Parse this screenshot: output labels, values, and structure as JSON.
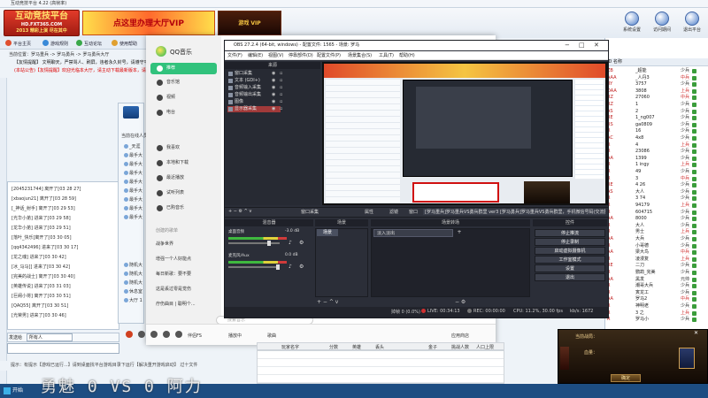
{
  "platform": {
    "title": "互动竞技平台 4.22 (高帧率)",
    "logo": {
      "line1": "互动竞技平台",
      "line2": "HD.FXT365.COM",
      "line3": "2013 精彩上演 尽在其中"
    },
    "ad_text": "点这里办理大厅VIP",
    "ad2_text": "游戏 VIP",
    "top_icons": [
      "系统设置",
      "访问期间",
      "退出平台"
    ],
    "nav": [
      "平台主页",
      "游戏规则",
      "互动论坛",
      "使用帮助"
    ],
    "breadcrumb": "当前位置：罗马重兵 -> 罗马勇兵 -> 罗马勇兵大厅",
    "notice1": "【友情提醒】 文明聊天，严禁骂人、刷屏，违者永久封号，请遵守平台规定。",
    "notice2": "(本站公告)【友情提醒】欢迎光临本大厅，请主动下载最新版本，请遵守平台规定。",
    "status": "提示：有提示【游戏已运行...】请到桌面找平台游戏目录下运行【解决重开游戏启动】 过十文件",
    "score": "勇魅 0 VS 0 阿力",
    "start": "开始"
  },
  "chat": {
    "lines": [
      "[2045231744] 离开了[03 28 27]",
      "[xbaojun21] 离开了[03 28 59]",
      "[_神话_射手] 离开了[03 29 53]",
      "[光华小弟] 进来了[03 29 58]",
      "[龙华小弟] 进来了[03 29 51]",
      "[落叶_快乐]离开了[03 30 05]",
      "[qq4342496] 进来了[03 30 17]",
      "[龙之魂] 进来了[03 30 42]",
      "[冰_马马]] 进来了[03 30 42]",
      "[完美的战士] 离开了[03 30 40]",
      "[英雄传说] 进来了[03 31 03]",
      "[巨阙小将] 离开了[03 30 51]",
      "[QAQ55] 离开了[03 30 51]",
      "[光荣男] 进来了[03 30 46]"
    ],
    "to_label": "发送给",
    "to_value": "所有人"
  },
  "members": {
    "title": "当前在线人员",
    "rows": [
      "_天涯",
      "最手大",
      "最手大",
      "最手大",
      "最手大",
      "最手大",
      "最手大",
      "最手大",
      "最手大",
      "随机大",
      "随机大",
      "随机大",
      "休息室",
      "大厅 1"
    ]
  },
  "user_list": {
    "header": "ID    名称",
    "rows": [
      {
        "id": "ZB",
        "name": "_超能",
        "status": "少兵"
      },
      {
        "id": "AAA",
        "name": "_人丹3",
        "status": "中兵"
      },
      {
        "id": "RY",
        "name": "3757",
        "status": "少兵"
      },
      {
        "id": "DAA",
        "name": "3808",
        "status": "上兵"
      },
      {
        "id": "RZ",
        "name": "27060",
        "status": "中兵"
      },
      {
        "id": "RZ",
        "name": "1",
        "status": "少兵"
      },
      {
        "id": "AS",
        "name": "2",
        "status": "少兵"
      },
      {
        "id": "RE",
        "name": "1_ng007",
        "status": "少兵"
      },
      {
        "id": "RS",
        "name": "ga0809",
        "status": "少兵"
      },
      {
        "id": "R",
        "name": "16",
        "status": "少兵"
      },
      {
        "id": "AC",
        "name": "4x8",
        "status": "少兵"
      },
      {
        "id": "R",
        "name": "4",
        "status": "上兵"
      },
      {
        "id": "R",
        "name": "23086",
        "status": "少兵"
      },
      {
        "id": "AA",
        "name": "1399",
        "status": "少兵"
      },
      {
        "id": "R",
        "name": "1 ingy",
        "status": "上兵"
      },
      {
        "id": "R",
        "name": "49",
        "status": "少兵"
      },
      {
        "id": "R",
        "name": "3",
        "status": "中兵"
      },
      {
        "id": "RE",
        "name": "4 26",
        "status": "少兵"
      },
      {
        "id": "AS",
        "name": "大人",
        "status": "少兵"
      },
      {
        "id": "R",
        "name": "3 74",
        "status": "少兵"
      },
      {
        "id": "R",
        "name": "94179",
        "status": "上兵"
      },
      {
        "id": "R",
        "name": "604715",
        "status": "少兵"
      },
      {
        "id": "AA",
        "name": "8000",
        "status": "少兵"
      },
      {
        "id": "R",
        "name": "大人",
        "status": "少兵"
      },
      {
        "id": "R",
        "name": "男士",
        "status": "上兵"
      },
      {
        "id": "AA",
        "name": "大兵",
        "status": "少兵"
      },
      {
        "id": "R",
        "name": "小哥德",
        "status": "少兵"
      },
      {
        "id": "AA",
        "name": "梁大鸟",
        "status": "中兵"
      },
      {
        "id": "R",
        "name": "凌漫复",
        "status": "上兵"
      },
      {
        "id": "RE",
        "name": "二刀",
        "status": "少兵"
      },
      {
        "id": "R",
        "name": "鹦鹉_完美",
        "status": "少兵"
      },
      {
        "id": "AA",
        "name": "黑发",
        "status": "元帅"
      },
      {
        "id": "R",
        "name": "潮哥大兵",
        "status": "少兵"
      },
      {
        "id": "R",
        "name": "寅龙工",
        "status": "少兵"
      },
      {
        "id": "AA",
        "name": "罗马2",
        "status": "中兵"
      },
      {
        "id": "R",
        "name": "神明老",
        "status": "少兵"
      },
      {
        "id": "R",
        "name": "3 之",
        "status": "上兵"
      },
      {
        "id": "R",
        "name": "罗马小",
        "status": "少兵"
      }
    ]
  },
  "qqmusic": {
    "brand": "QQ音乐",
    "nav": [
      "推荐",
      "音乐馆",
      "视频",
      "电台"
    ],
    "my_music": [
      "我喜欢",
      "本地和下载",
      "最近播放",
      "试听列表",
      "已购音乐"
    ],
    "create_title": "创建的歌单",
    "playlists": [
      "战争世界",
      "增强一个人好能点",
      "每日新歌：要不要",
      "这是丢过零是觉伤",
      "疗伤曲目 | 聪明个..."
    ],
    "search_placeholder": "搜索音乐",
    "song": "伴侣FS",
    "lyric": "播放中",
    "settings": "歌曲",
    "right_actions": "应用商店",
    "table_heads": [
      "玩家名字",
      "分数",
      "英雄",
      "丢头",
      "金子",
      "挑战人数",
      "人口上限"
    ]
  },
  "obs": {
    "title": "OBS 27.2.4 (64-bit, windows) - 配置文件: 1565 - 场景: 罗马",
    "menu": [
      "文件(F)",
      "编辑(E)",
      "视图(V)",
      "停靠部件(D)",
      "配置文件(P)",
      "场景集合(S)",
      "工具(T)",
      "帮助(H)"
    ],
    "scenes_header": "来源",
    "scenes": [
      "窗口采集",
      "文本 (GDI+)",
      "音频输入采集",
      "音频输出采集",
      "图像",
      "显示器采集"
    ],
    "toolbar": [
      "窗口采集",
      "属性",
      "滤镜",
      "窗口",
      "[罗马重兵]罗马重兵VS勇兵群里 ver3 [罗马勇兵]罗马重兵VS勇兵群里，手机微信号码(交流群) 1"
    ],
    "sources_header": "混音器",
    "mixer": [
      {
        "label": "桌面音频",
        "db": "-3.0 dB"
      },
      {
        "label": "麦克风/Aux",
        "db": "0.0 dB"
      }
    ],
    "transition_header": "场景",
    "transition_item": "场景",
    "filter_header": "场景转场",
    "filter_select": "淡入淡出",
    "controls_header": "控件",
    "controls": [
      "停止推流",
      "停止录制",
      "启动虚拟摄像机",
      "工作室模式",
      "设置",
      "退出"
    ],
    "status": {
      "dropped": "掉帧 0 (0.0%)",
      "live": "LIVE: 00:34:13",
      "rec": "REC: 00:00:00",
      "cpu": "CPU: 11.2%, 30.00 fps",
      "kbps": "kb/s: 1672"
    }
  },
  "game": {
    "title": "当前战局：",
    "hp": "血量：",
    "button": "确定"
  }
}
